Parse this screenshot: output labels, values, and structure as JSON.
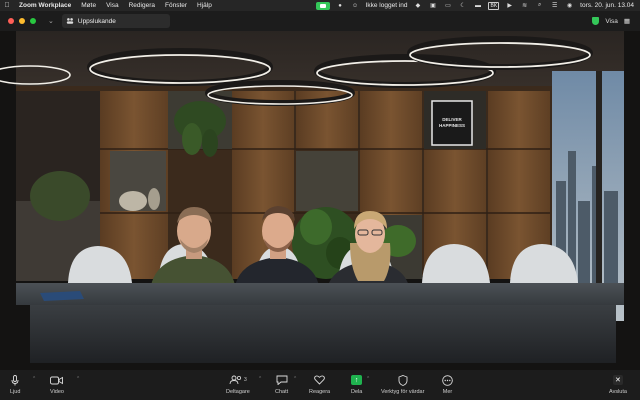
{
  "menubar": {
    "app_name": "Zoom Workplace",
    "items": [
      "Møte",
      "Visa",
      "Redigera",
      "Fönster",
      "Hjälp"
    ],
    "status": "Ikke logget ind",
    "badge": "BK",
    "clock": "tors. 20. jun.  13.04"
  },
  "titlebar": {
    "background_button": "Uppslukande",
    "view_label": "Visa"
  },
  "scene": {
    "wall_sign": [
      "DELIVER",
      "HAPPINESS"
    ]
  },
  "toolbar": {
    "items": [
      {
        "label": "Ljud",
        "icon": "microphone-icon"
      },
      {
        "label": "Video",
        "icon": "video-camera-icon"
      },
      {
        "label": "Deltagare",
        "icon": "participants-icon",
        "count": "3"
      },
      {
        "label": "Chatt",
        "icon": "chat-icon"
      },
      {
        "label": "Reagera",
        "icon": "heart-icon"
      },
      {
        "label": "Dela",
        "icon": "share-screen-icon"
      },
      {
        "label": "Verktyg för värdar",
        "icon": "host-tools-icon"
      },
      {
        "label": "Mer",
        "icon": "more-icon"
      },
      {
        "label": "Avsluta",
        "icon": "end-meeting-icon"
      }
    ]
  },
  "colors": {
    "share_green": "#1fb34f",
    "camera_indicator": "#34c759",
    "toolbar_bg": "#1c1c1c"
  }
}
